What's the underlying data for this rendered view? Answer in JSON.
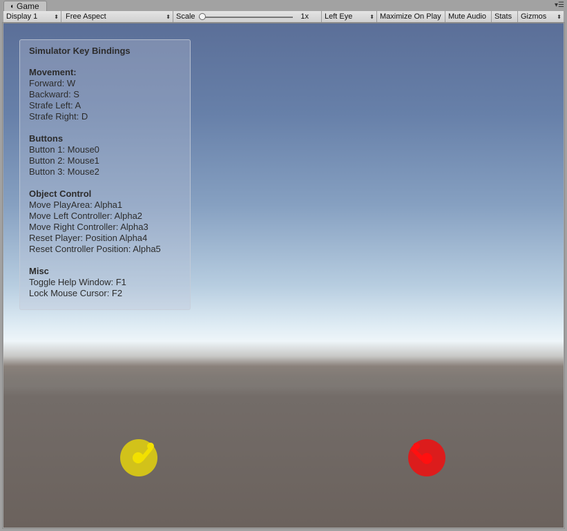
{
  "window": {
    "tab_icon": "unity-game-icon",
    "tab_label": "Game",
    "menu_icon": "▾☰"
  },
  "toolbar": {
    "display": "Display 1",
    "aspect": "Free Aspect",
    "scale_label": "Scale",
    "scale_value": "1x",
    "scale_fraction": 0,
    "eye": "Left Eye",
    "maximize": "Maximize On Play",
    "mute": "Mute Audio",
    "stats": "Stats",
    "gizmos": "Gizmos"
  },
  "help_window": {
    "title": "Simulator Key Bindings",
    "sections": [
      {
        "heading": "Movement:",
        "lines": [
          "Forward: W",
          "Backward: S",
          "Strafe Left: A",
          "Strafe Right: D"
        ]
      },
      {
        "heading": "Buttons",
        "lines": [
          "Button 1: Mouse0",
          "Button 2: Mouse1",
          "Button 3: Mouse2"
        ]
      },
      {
        "heading": "Object Control",
        "lines": [
          "Move PlayArea: Alpha1",
          "Move Left Controller: Alpha2",
          "Move Right Controller: Alpha3",
          "Reset Player: Position Alpha4",
          "Reset Controller Position: Alpha5"
        ]
      },
      {
        "heading": "Misc",
        "lines": [
          "Toggle Help Window: F1",
          "Lock Mouse Cursor: F2"
        ]
      }
    ]
  },
  "scene": {
    "left_controller_color": "#f2e000",
    "left_controller_disk": "#d2c21a",
    "right_controller_color": "#ff1010",
    "right_controller_disk": "#dc1c1c"
  }
}
